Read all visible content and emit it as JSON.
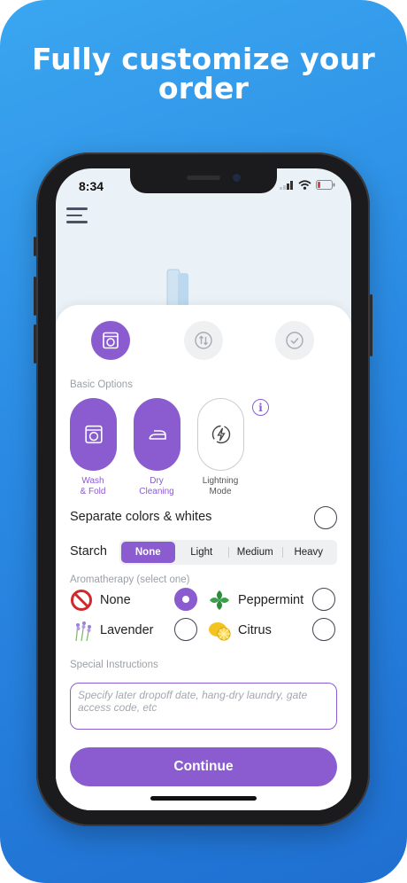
{
  "headline": {
    "line1": "Fully customize your",
    "line2": "order"
  },
  "status_bar": {
    "time": "8:34"
  },
  "steps": [
    {
      "icon": "washer-icon",
      "state": "active"
    },
    {
      "icon": "swap-arrows-icon",
      "state": "idle"
    },
    {
      "icon": "check-icon",
      "state": "idle"
    }
  ],
  "basic_options": {
    "label": "Basic Options",
    "services": [
      {
        "label_line1": "Wash",
        "label_line2": "& Fold",
        "selected": true
      },
      {
        "label_line1": "Dry",
        "label_line2": "Cleaning",
        "selected": true
      },
      {
        "label_line1": "Lightning",
        "label_line2": "Mode",
        "selected": false
      }
    ],
    "info_glyph": "i"
  },
  "separate": {
    "label": "Separate colors & whites",
    "checked": false
  },
  "starch": {
    "label": "Starch",
    "options": [
      "None",
      "Light",
      "Medium",
      "Heavy"
    ],
    "selected": "None"
  },
  "aromatherapy": {
    "label": "Aromatherapy (select one)",
    "options": [
      {
        "label": "None",
        "icon": "no-symbol-icon",
        "checked": true
      },
      {
        "label": "Peppermint",
        "icon": "mint-leaf-icon",
        "checked": false
      },
      {
        "label": "Lavender",
        "icon": "lavender-icon",
        "checked": false
      },
      {
        "label": "Citrus",
        "icon": "lemon-icon",
        "checked": false
      }
    ]
  },
  "special_instructions": {
    "label": "Special Instructions",
    "placeholder": "Specify later dropoff date, hang-dry laundry, gate access code, etc"
  },
  "continue_label": "Continue",
  "colors": {
    "accent": "#8a5cd0",
    "background_blue": "#2a8ae3"
  }
}
